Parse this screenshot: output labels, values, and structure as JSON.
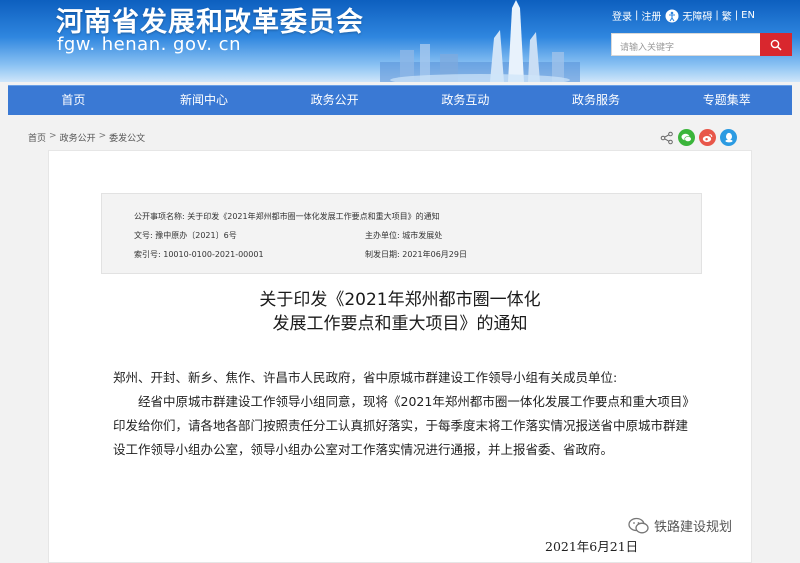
{
  "header": {
    "site_title": "河南省发展和改革委员会",
    "site_domain": "fgw. henan. gov. cn",
    "top_links": {
      "login": "登录",
      "register": "注册",
      "accessibility": "无障碍",
      "traditional": "繁",
      "english": "EN"
    },
    "search": {
      "placeholder": "请输入关键字"
    }
  },
  "nav": [
    "首页",
    "新闻中心",
    "政务公开",
    "政务互动",
    "政务服务",
    "专题集萃"
  ],
  "breadcrumb": [
    "首页",
    "政务公开",
    "委发公文"
  ],
  "meta": {
    "item_name_label": "公开事项名称:",
    "item_name": "关于印发《2021年郑州都市圈一体化发展工作要点和重大项目》的通知",
    "doc_no_label": "文号:",
    "doc_no": "豫中原办〔2021〕6号",
    "host_unit_label": "主办单位:",
    "host_unit": "城市发展处",
    "index_label": "索引号:",
    "index_no": "10010-0100-2021-00001",
    "date_label": "制发日期:",
    "date": "2021年06月29日"
  },
  "document": {
    "title_line1": "关于印发《2021年郑州都市圈一体化",
    "title_line2": "发展工作要点和重大项目》的通知",
    "addressee": "郑州、开封、新乡、焦作、许昌市人民政府，省中原城市群建设工作领导小组有关成员单位:",
    "paragraph": "经省中原城市群建设工作领导小组同意，现将《2021年郑州都市圈一体化发展工作要点和重大项目》印发给你们，请各地各部门按照责任分工认真抓好落实，于每季度末将工作落实情况报送省中原城市群建设工作领导小组办公室，领导小组办公室对工作落实情况进行通报，并上报省委、省政府。",
    "sign_date": "2021年6月21日"
  },
  "watermark": "铁路建设规划",
  "colors": {
    "nav": "#3a79d4",
    "search_button": "#d9272e",
    "wechat": "#3bb53b",
    "weibo": "#e8574a",
    "qq": "#2c9be2"
  }
}
